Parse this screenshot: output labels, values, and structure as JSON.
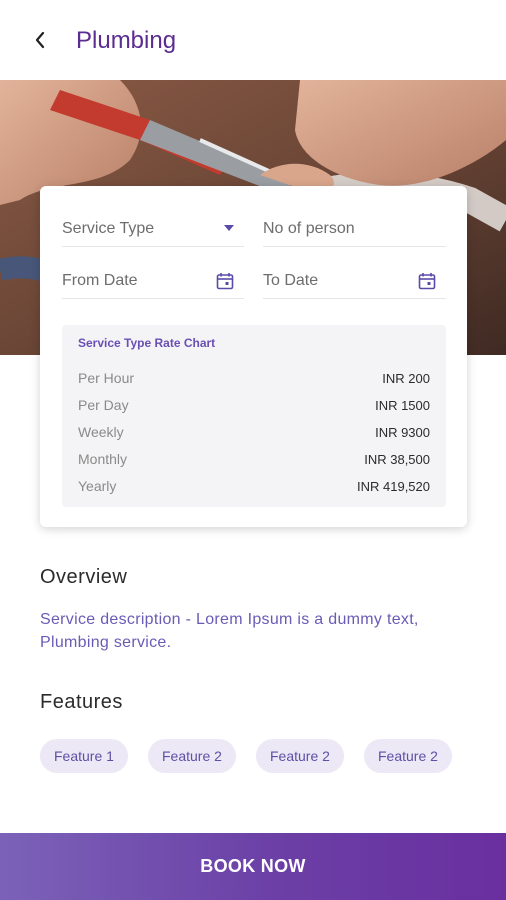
{
  "header": {
    "title": "Plumbing",
    "back_icon": "chevron-left-icon"
  },
  "booking_form": {
    "service_type_label": "Service Type",
    "persons_label": "No of person",
    "from_date_label": "From Date",
    "to_date_label": "To Date"
  },
  "rate_chart": {
    "title": "Service Type Rate Chart",
    "rows": [
      {
        "label": "Per Hour",
        "value": "INR 200"
      },
      {
        "label": "Per Day",
        "value": "INR 1500"
      },
      {
        "label": "Weekly",
        "value": "INR 9300"
      },
      {
        "label": "Monthly",
        "value": "INR 38,500"
      },
      {
        "label": "Yearly",
        "value": "INR 419,520"
      }
    ]
  },
  "overview": {
    "heading": "Overview",
    "text": "Service description - Lorem Ipsum is a dummy text, Plumbing service."
  },
  "features": {
    "heading": "Features",
    "chips": [
      "Feature 1",
      "Feature 2",
      "Feature 2",
      "Feature 2"
    ]
  },
  "cta": {
    "label": "BOOK NOW"
  },
  "colors": {
    "accent": "#5b2c91",
    "link_text": "#6a5bb5",
    "chip_bg": "#ede8f6"
  }
}
